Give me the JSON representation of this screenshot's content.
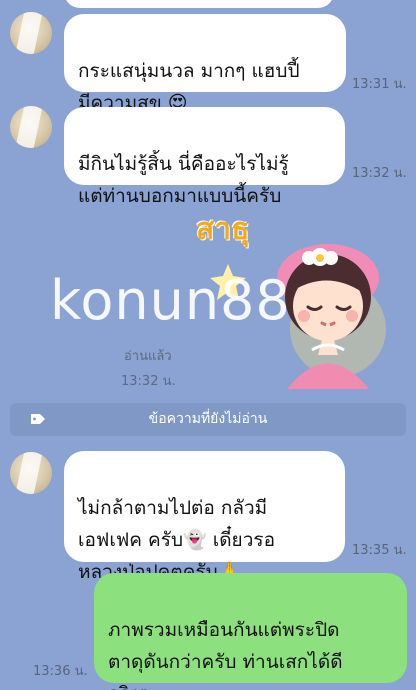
{
  "messages": [
    {
      "text": "กระแสนุ่มนวล มากๆ  แฮบปี้\nมีความสุข 😍",
      "time": "13:31 น."
    },
    {
      "text": "มีกินไม่รู้สิ้น นี่คืออะไรไม่รู้\nแต่ท่านบอกมาแบบนี้ครับ",
      "time": "13:32 น."
    },
    {
      "text": "ไม่กล้าตามไปต่อ กลัวมี\nเอฟเฟค ครับ👻  เดี๋ยวรอ\nหลวงปู่อุปคุตครับ🙏",
      "time": "13:35 น."
    }
  ],
  "sticker": {
    "text": "สาธุ",
    "icon": "praying-girl-sticker",
    "read_label": "อ่านแล้ว",
    "time": "13:32 น."
  },
  "watermark": {
    "text": "konun88"
  },
  "unread_divider": {
    "label": "ข้อความที่ยังไม่อ่าน",
    "icon": "tag-icon"
  },
  "outgoing": {
    "text": "ภาพรวมเหมือนกันแต่พระปิด\nตาดุดันกว่าครับ ท่านเสกได้ดี\nจริงๆ",
    "time": "13:36 น."
  },
  "colors": {
    "background": "#8aa3d3",
    "incoming_bubble": "#ffffff",
    "outgoing_bubble": "#8de07e",
    "divider": "#7f98c6",
    "sticker_text": "#f1a91d"
  }
}
